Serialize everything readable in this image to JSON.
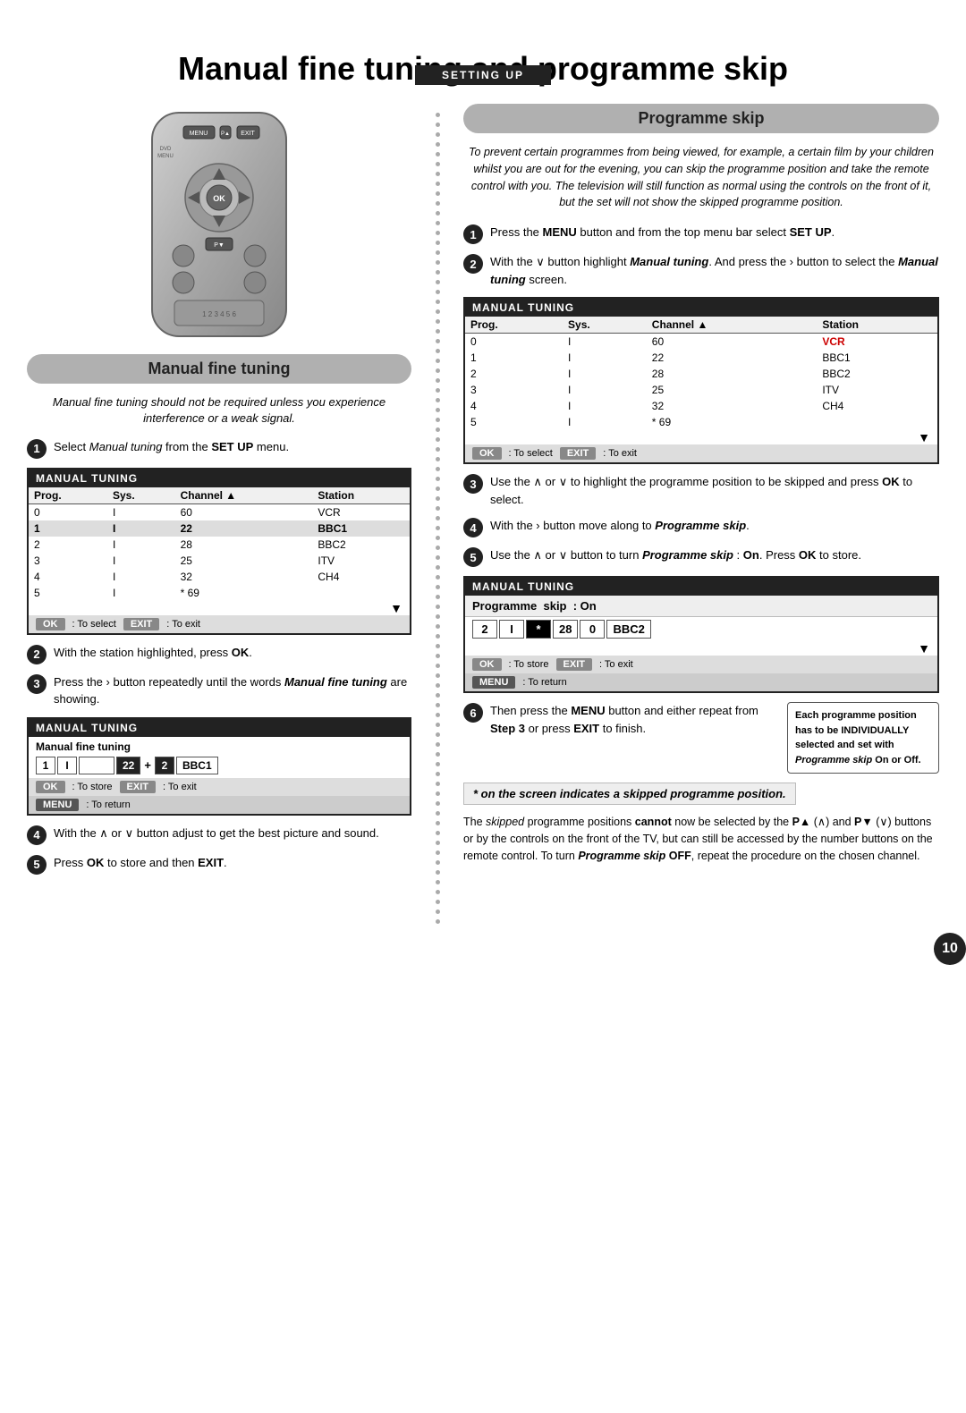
{
  "header": {
    "setting_up": "SETTING UP",
    "page_title": "Manual fine tuning and programme skip"
  },
  "left": {
    "section_title": "Manual fine tuning",
    "intro": "Manual fine tuning should not be required unless you experience interference or a weak signal.",
    "steps": [
      {
        "num": "1",
        "text": "Select Manual tuning from the SET UP menu."
      },
      {
        "num": "2",
        "text": "With the station highlighted, press OK."
      },
      {
        "num": "3",
        "text": "Press the › button repeatedly until the words Manual fine tuning are showing."
      },
      {
        "num": "4",
        "text": "With the ∧ or ∨ button adjust to get the best picture and sound."
      },
      {
        "num": "5",
        "text": "Press OK to store and then EXIT."
      }
    ],
    "tuning_table_1": {
      "title": "MANUAL TUNING",
      "headers": [
        "Prog.",
        "Sys.",
        "Channel ▲",
        "Station"
      ],
      "rows": [
        {
          "prog": "0",
          "sys": "I",
          "channel": "60",
          "station": "VCR",
          "highlighted": false
        },
        {
          "prog": "1",
          "sys": "I",
          "channel": "22",
          "station": "BBC1",
          "highlighted": true
        },
        {
          "prog": "2",
          "sys": "I",
          "channel": "28",
          "station": "BBC2",
          "highlighted": false
        },
        {
          "prog": "3",
          "sys": "I",
          "channel": "25",
          "station": "ITV",
          "highlighted": false
        },
        {
          "prog": "4",
          "sys": "I",
          "channel": "32",
          "station": "CH4",
          "highlighted": false
        },
        {
          "prog": "5",
          "sys": "I",
          "channel": "* 69",
          "station": "",
          "highlighted": false
        }
      ],
      "ok_label": "OK",
      "ok_text": ": To select",
      "exit_label": "EXIT",
      "exit_text": ": To exit"
    },
    "fine_tune_box": {
      "title": "MANUAL TUNING",
      "header_label": "Manual  fine  tuning",
      "cells": [
        "1",
        "I",
        "",
        "",
        "22",
        "+",
        "2",
        "BBC1"
      ],
      "ok_label": "OK",
      "ok_text": ": To store",
      "exit_label": "EXIT",
      "exit_text": ": To exit",
      "menu_label": "MENU",
      "menu_text": ": To return"
    }
  },
  "right": {
    "section_title": "Programme skip",
    "intro": "To prevent certain programmes from being viewed, for example, a certain film by your children whilst you are out for the evening, you can skip the programme position and take the remote control with you. The television will still function as normal using the controls on the front of it, but the set will not show the skipped programme position.",
    "steps": [
      {
        "num": "1",
        "text": "Press the MENU button and from the top menu bar select SET UP."
      },
      {
        "num": "2",
        "text": "With the ∨ button highlight Manual tuning. And press the › button to select the Manual tuning screen."
      },
      {
        "num": "3",
        "text": "Use the ∧ or ∨ to highlight the programme position to be skipped and press OK to select."
      },
      {
        "num": "4",
        "text": "With the › button move along to Programme skip."
      },
      {
        "num": "5",
        "text": "Use the ∧ or ∨ button to turn Programme skip : On. Press OK to store."
      },
      {
        "num": "6",
        "text_a": "Then press the MENU button and either repeat from Step 3 or press EXIT to finish.",
        "callout": "Each programme position has to be INDIVIDUALLY selected and set with Programme skip On or Off."
      }
    ],
    "tuning_table_2": {
      "title": "MANUAL TUNING",
      "headers": [
        "Prog.",
        "Sys.",
        "Channel ▲",
        "Station"
      ],
      "rows": [
        {
          "prog": "0",
          "sys": "I",
          "channel": "60",
          "station": "VCR",
          "highlighted": false
        },
        {
          "prog": "1",
          "sys": "I",
          "channel": "22",
          "station": "BBC1",
          "highlighted": true
        },
        {
          "prog": "2",
          "sys": "I",
          "channel": "28",
          "station": "BBC2",
          "highlighted": false
        },
        {
          "prog": "3",
          "sys": "I",
          "channel": "25",
          "station": "ITV",
          "highlighted": false
        },
        {
          "prog": "4",
          "sys": "I",
          "channel": "32",
          "station": "CH4",
          "highlighted": false
        },
        {
          "prog": "5",
          "sys": "I",
          "channel": "* 69",
          "station": "",
          "highlighted": false
        }
      ],
      "ok_label": "OK",
      "ok_text": ": To select",
      "exit_label": "EXIT",
      "exit_text": ": To exit"
    },
    "skip_box": {
      "title": "MANUAL TUNING",
      "prog_skip_label": "Programme",
      "skip_word": "skip",
      "on_label": ": On",
      "cells": [
        "2",
        "I",
        "*",
        "28",
        "0",
        "BBC2"
      ],
      "ok_label": "OK",
      "ok_text": ": To store",
      "exit_label": "EXIT",
      "exit_text": ": To exit",
      "menu_label": "MENU",
      "menu_text": ": To return"
    },
    "asterisk_note": "* on the screen indicates a skipped programme position.",
    "bottom_note": "The skipped programme positions cannot now be selected by the P▲ (∧) and P▼ (∨) buttons or by the controls on the front of the TV, but can still be accessed by the number buttons on the remote control. To turn Programme skip OFF, repeat the procedure on the chosen channel."
  },
  "page_number": "10"
}
